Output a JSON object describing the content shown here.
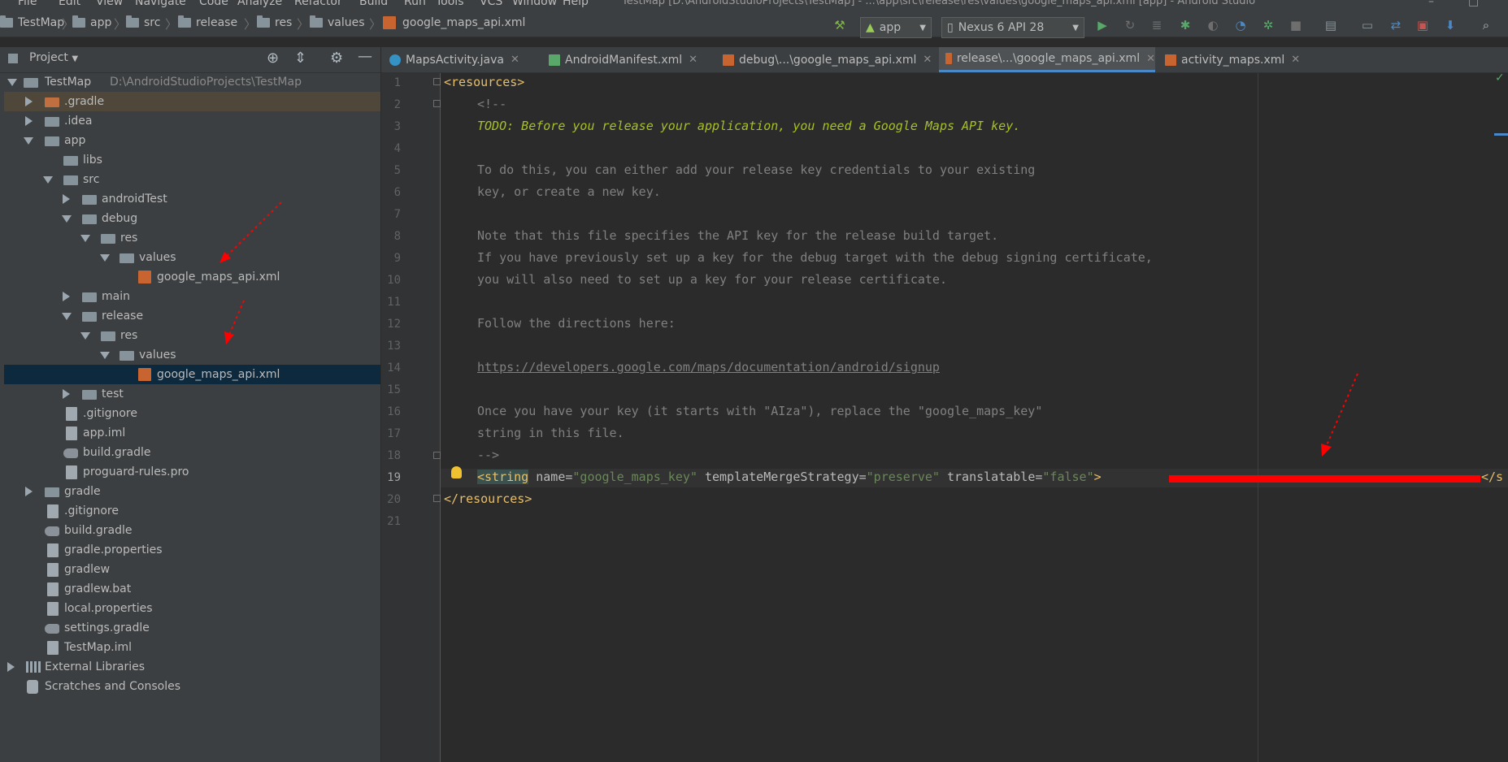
{
  "menu": {
    "items": [
      "File",
      "Edit",
      "View",
      "Navigate",
      "Code",
      "Analyze",
      "Refactor",
      "Build",
      "Run",
      "Tools",
      "VCS",
      "Window",
      "Help"
    ],
    "window_title": "TestMap [D:\\AndroidStudioProjects\\TestMap] - ...\\app\\src\\release\\res\\values\\google_maps_api.xml [app] - Android Studio"
  },
  "breadcrumbs": [
    "TestMap",
    "app",
    "src",
    "release",
    "res",
    "values",
    "google_maps_api.xml"
  ],
  "toolbar": {
    "run_config": "app",
    "device": "Nexus 6 API 28"
  },
  "project_panel": {
    "title": "Project",
    "rows": [
      {
        "label": "TestMap",
        "sub": "D:\\AndroidStudioProjects\\TestMap"
      },
      {
        "label": ".gradle"
      },
      {
        "label": ".idea"
      },
      {
        "label": "app"
      },
      {
        "label": "libs"
      },
      {
        "label": "src"
      },
      {
        "label": "androidTest"
      },
      {
        "label": "debug"
      },
      {
        "label": "res"
      },
      {
        "label": "values"
      },
      {
        "label": "google_maps_api.xml"
      },
      {
        "label": "main"
      },
      {
        "label": "release"
      },
      {
        "label": "res"
      },
      {
        "label": "values"
      },
      {
        "label": "google_maps_api.xml"
      },
      {
        "label": "test"
      },
      {
        "label": ".gitignore"
      },
      {
        "label": "app.iml"
      },
      {
        "label": "build.gradle"
      },
      {
        "label": "proguard-rules.pro"
      },
      {
        "label": "gradle"
      },
      {
        "label": ".gitignore"
      },
      {
        "label": "build.gradle"
      },
      {
        "label": "gradle.properties"
      },
      {
        "label": "gradlew"
      },
      {
        "label": "gradlew.bat"
      },
      {
        "label": "local.properties"
      },
      {
        "label": "settings.gradle"
      },
      {
        "label": "TestMap.iml"
      },
      {
        "label": "External Libraries"
      },
      {
        "label": "Scratches and Consoles"
      }
    ]
  },
  "tabs": [
    {
      "label": "MapsActivity.java"
    },
    {
      "label": "AndroidManifest.xml"
    },
    {
      "label": "debug\\...\\google_maps_api.xml"
    },
    {
      "label": "release\\...\\google_maps_api.xml"
    },
    {
      "label": "activity_maps.xml"
    }
  ],
  "editor": {
    "line_numbers": [
      "1",
      "2",
      "3",
      "4",
      "5",
      "6",
      "7",
      "8",
      "9",
      "10",
      "11",
      "12",
      "13",
      "14",
      "15",
      "16",
      "17",
      "18",
      "19",
      "20",
      "21"
    ],
    "lines": {
      "l1": "<resources>",
      "l2": "<!--",
      "l3": "TODO: Before you release your application, you need a Google Maps API key.",
      "l5": "To do this, you can either add your release key credentials to your existing",
      "l6": "key, or create a new key.",
      "l8": "Note that this file specifies the API key for the release build target.",
      "l9": "If you have previously set up a key for the debug target with the debug signing certificate,",
      "l10": "you will also need to set up a key for your release certificate.",
      "l12": "Follow the directions here:",
      "l14": "https://developers.google.com/maps/documentation/android/signup",
      "l16": "Once you have your key (it starts with \"AIza\"), replace the \"google_maps_key\"",
      "l17": "string in this file.",
      "l18": "-->",
      "l19_tag": "<string",
      "l19_attr1": "name=",
      "l19_val1": "\"google_maps_key\"",
      "l19_attr2": "templateMergeStrategy=",
      "l19_val2": "\"preserve\"",
      "l19_attr3": "translatable=",
      "l19_val3": "\"false\"",
      "l19_close": ">",
      "l19_end": "</s",
      "l20": "</resources>"
    }
  },
  "colors": {
    "annotation_arrows": "#ff0000",
    "redaction": "#ff0000"
  }
}
